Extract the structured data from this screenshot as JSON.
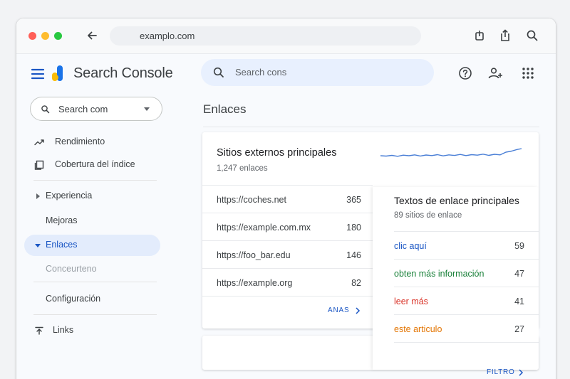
{
  "browser": {
    "url": "examplo.com"
  },
  "app": {
    "name": "Search Console",
    "search_placeholder": "Search cons"
  },
  "sidebar": {
    "property": "Search com",
    "items": [
      {
        "label": "Rendimiento"
      },
      {
        "label": "Cobertura del índice"
      },
      {
        "label": "Experiencia"
      },
      {
        "label": "Mejoras"
      },
      {
        "label": "Enlaces"
      },
      {
        "label": "Conceurteno"
      },
      {
        "label": "Configuración"
      },
      {
        "label": "Links"
      }
    ]
  },
  "main": {
    "title": "Enlaces",
    "external": {
      "title": "Sitios externos principales",
      "subtitle": "1,247 enlaces",
      "rows": [
        {
          "url": "https://coches.net",
          "count": "365"
        },
        {
          "url": "https://example.com.mx",
          "count": "180"
        },
        {
          "url": "https://foo_bar.edu",
          "count": "146"
        },
        {
          "url": "https://example.org",
          "count": "82"
        }
      ],
      "more_label": "ANAS"
    },
    "anchor": {
      "title": "Textos de enlace principales",
      "subtitle": "89 sitios de enlace",
      "rows": [
        {
          "text": "clic aquí",
          "count": "59",
          "color": "#1a56c4"
        },
        {
          "text": "obten más información",
          "count": "47",
          "color": "#188038"
        },
        {
          "text": "leer más",
          "count": "41",
          "color": "#d93025"
        },
        {
          "text": "este articulo",
          "count": "27",
          "color": "#e37400"
        }
      ],
      "more_label": "FILTRO"
    }
  }
}
